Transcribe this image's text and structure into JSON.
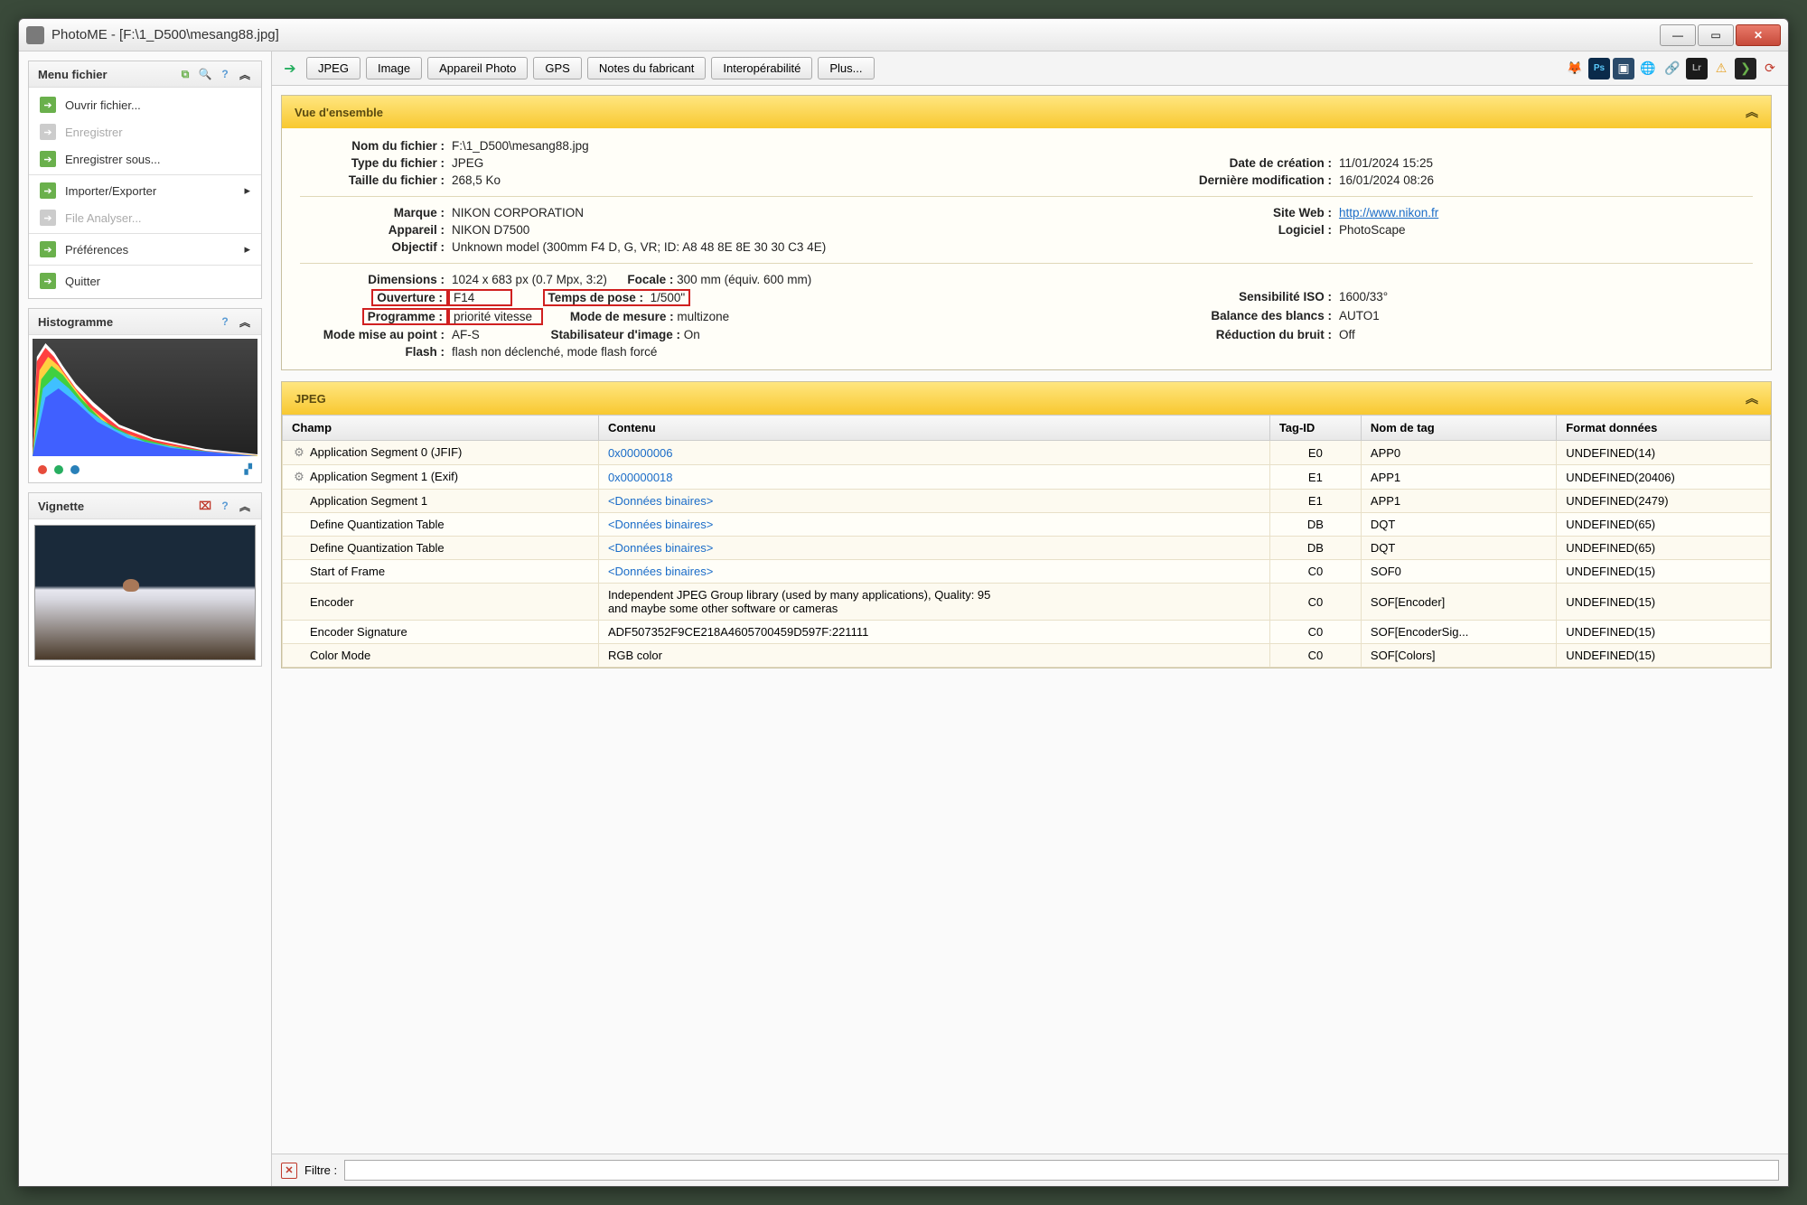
{
  "window": {
    "title": "PhotoME - [F:\\1_D500\\mesang88.jpg]"
  },
  "sidebar": {
    "file_menu": {
      "title": "Menu fichier",
      "items": [
        {
          "label": "Ouvrir fichier...",
          "disabled": false,
          "submenu": false
        },
        {
          "label": "Enregistrer",
          "disabled": true,
          "submenu": false
        },
        {
          "label": "Enregistrer sous...",
          "disabled": false,
          "submenu": false
        },
        {
          "label": "Importer/Exporter",
          "disabled": false,
          "submenu": true
        },
        {
          "label": "File Analyser...",
          "disabled": true,
          "submenu": false
        },
        {
          "label": "Préférences",
          "disabled": false,
          "submenu": true
        },
        {
          "label": "Quitter",
          "disabled": false,
          "submenu": false
        }
      ]
    },
    "histogram": {
      "title": "Histogramme"
    },
    "thumbnail": {
      "title": "Vignette"
    }
  },
  "toolbar": {
    "tabs": [
      "JPEG",
      "Image",
      "Appareil Photo",
      "GPS",
      "Notes du fabricant",
      "Interopérabilité",
      "Plus..."
    ]
  },
  "overview": {
    "title": "Vue d'ensemble",
    "rows": {
      "file_name_label": "Nom du fichier :",
      "file_name": "F:\\1_D500\\mesang88.jpg",
      "file_type_label": "Type du fichier :",
      "file_type": "JPEG",
      "creation_label": "Date de création :",
      "creation": "11/01/2024 15:25",
      "file_size_label": "Taille du fichier :",
      "file_size": "268,5 Ko",
      "modified_label": "Dernière modification :",
      "modified": "16/01/2024 08:26",
      "make_label": "Marque :",
      "make": "NIKON CORPORATION",
      "website_label": "Site Web :",
      "website": "http://www.nikon.fr",
      "model_label": "Appareil :",
      "model": "NIKON D7500",
      "software_label": "Logiciel :",
      "software": "PhotoScape",
      "lens_label": "Objectif :",
      "lens": "Unknown model (300mm F4 D, G, VR; ID: A8 48 8E 8E 30 30 C3 4E)",
      "dimensions_label": "Dimensions :",
      "dimensions": "1024 x 683 px (0.7 Mpx, 3:2)",
      "focal_label": "Focale :",
      "focal": "300 mm (équiv. 600 mm)",
      "aperture_label": "Ouverture :",
      "aperture": "F14",
      "exposure_label": "Temps de pose :",
      "exposure": "1/500\"",
      "iso_label": "Sensibilité ISO :",
      "iso": "1600/33°",
      "program_label": "Programme :",
      "program": "priorité vitesse",
      "metering_label": "Mode de mesure :",
      "metering": "multizone",
      "wb_label": "Balance des blancs :",
      "wb": "AUTO1",
      "focus_label": "Mode mise au point :",
      "focus": "AF-S",
      "stabilizer_label": "Stabilisateur d'image :",
      "stabilizer": "On",
      "nr_label": "Réduction du bruit :",
      "nr": "Off",
      "flash_label": "Flash :",
      "flash": "flash non déclenché, mode flash forcé"
    }
  },
  "jpeg_section": {
    "title": "JPEG",
    "columns": [
      "Champ",
      "Contenu",
      "Tag-ID",
      "Nom de tag",
      "Format données"
    ],
    "rows": [
      {
        "icon": true,
        "champ": "Application Segment 0 (JFIF)",
        "contenu": "0x00000006",
        "link": true,
        "tag": "E0",
        "nom": "APP0",
        "format": "UNDEFINED(14)"
      },
      {
        "icon": true,
        "champ": "Application Segment 1 (Exif)",
        "contenu": "0x00000018",
        "link": true,
        "tag": "E1",
        "nom": "APP1",
        "format": "UNDEFINED(20406)"
      },
      {
        "icon": false,
        "champ": "Application Segment 1",
        "contenu": "<Données binaires>",
        "link": true,
        "tag": "E1",
        "nom": "APP1",
        "format": "UNDEFINED(2479)"
      },
      {
        "icon": false,
        "champ": "Define Quantization Table",
        "contenu": "<Données binaires>",
        "link": true,
        "tag": "DB",
        "nom": "DQT",
        "format": "UNDEFINED(65)"
      },
      {
        "icon": false,
        "champ": "Define Quantization Table",
        "contenu": "<Données binaires>",
        "link": true,
        "tag": "DB",
        "nom": "DQT",
        "format": "UNDEFINED(65)"
      },
      {
        "icon": false,
        "champ": "Start of Frame",
        "contenu": "<Données binaires>",
        "link": true,
        "tag": "C0",
        "nom": "SOF0",
        "format": "UNDEFINED(15)"
      },
      {
        "icon": false,
        "champ": "Encoder",
        "contenu": "Independent JPEG Group library (used by many applications), Quality: 95\nand maybe some other software or cameras",
        "link": false,
        "tag": "C0",
        "nom": "SOF[Encoder]",
        "format": "UNDEFINED(15)"
      },
      {
        "icon": false,
        "champ": "Encoder Signature",
        "contenu": "ADF507352F9CE218A4605700459D597F:221111",
        "link": false,
        "tag": "C0",
        "nom": "SOF[EncoderSig...",
        "format": "UNDEFINED(15)"
      },
      {
        "icon": false,
        "champ": "Color Mode",
        "contenu": "RGB color",
        "link": false,
        "tag": "C0",
        "nom": "SOF[Colors]",
        "format": "UNDEFINED(15)"
      }
    ]
  },
  "filter": {
    "label": "Filtre :",
    "value": ""
  }
}
